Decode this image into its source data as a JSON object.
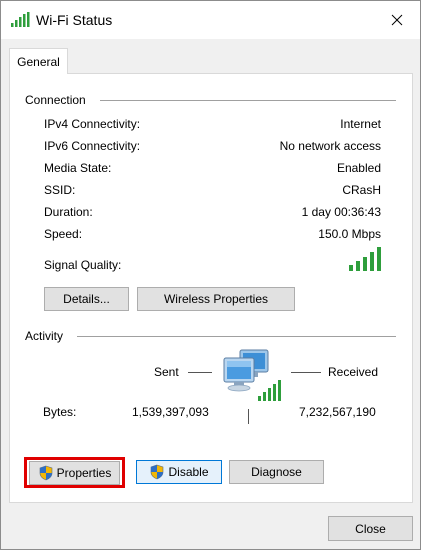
{
  "window": {
    "title": "Wi-Fi Status"
  },
  "tabs": [
    {
      "label": "General"
    }
  ],
  "connection": {
    "heading": "Connection",
    "rows": [
      {
        "label": "IPv4 Connectivity:",
        "value": "Internet"
      },
      {
        "label": "IPv6 Connectivity:",
        "value": "No network access"
      },
      {
        "label": "Media State:",
        "value": "Enabled"
      },
      {
        "label": "SSID:",
        "value": "CRasH"
      },
      {
        "label": "Duration:",
        "value": "1 day 00:36:43"
      },
      {
        "label": "Speed:",
        "value": "150.0 Mbps"
      }
    ],
    "signal_label": "Signal Quality:",
    "signal_bars": 5,
    "details_label": "Details...",
    "wireless_label": "Wireless Properties"
  },
  "activity": {
    "heading": "Activity",
    "sent_label": "Sent",
    "received_label": "Received",
    "bytes_label": "Bytes:",
    "bytes_sent": "1,539,397,093",
    "bytes_received": "7,232,567,190"
  },
  "actions": {
    "properties_label": "Properties",
    "disable_label": "Disable",
    "diagnose_label": "Diagnose",
    "close_label": "Close"
  },
  "colors": {
    "signal_green": "#2e9e3c",
    "highlight_red": "#e00000",
    "focus_blue": "#0078d7"
  }
}
